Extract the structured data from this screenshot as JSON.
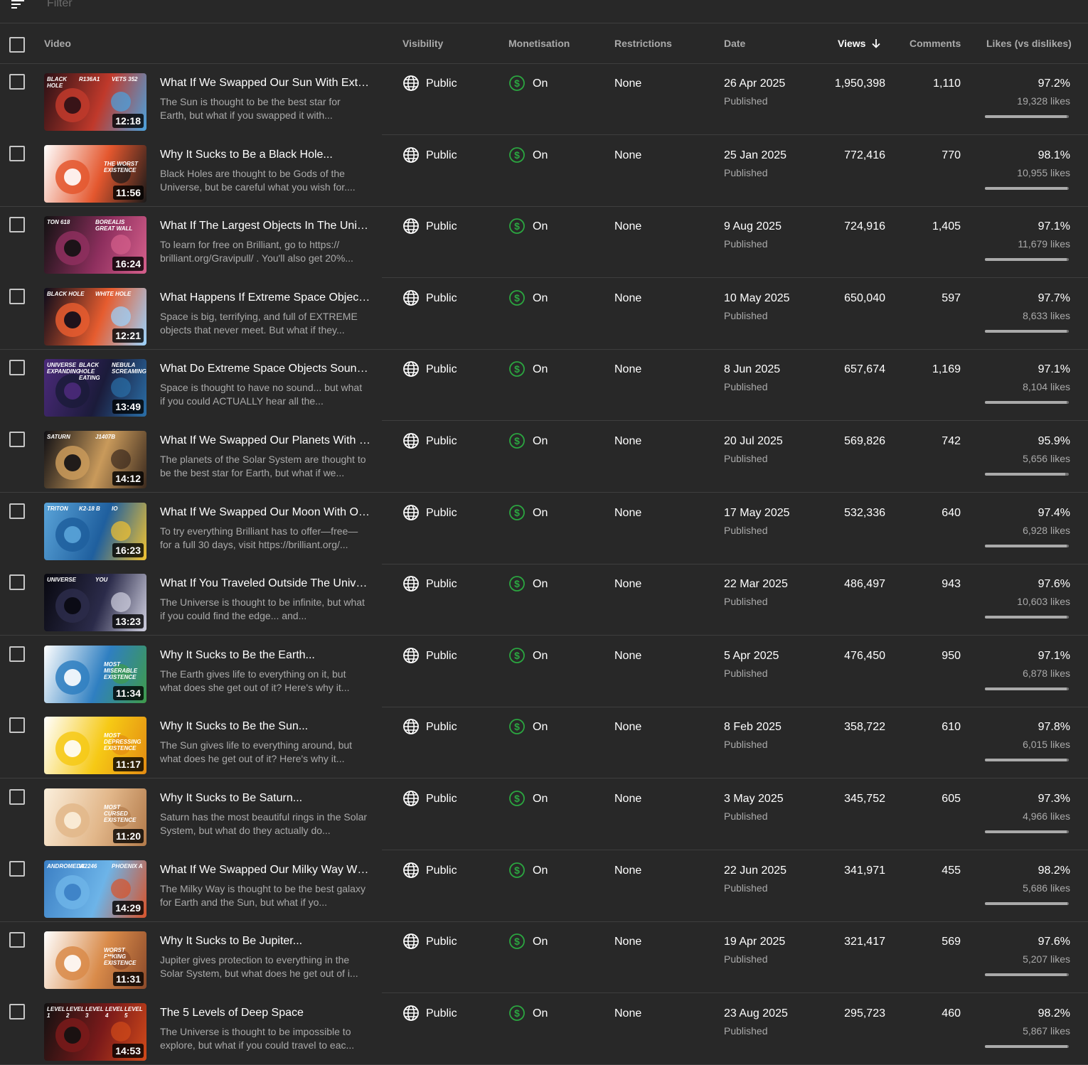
{
  "filter": {
    "placeholder": "Filter"
  },
  "columns": {
    "video": "Video",
    "visibility": "Visibility",
    "monetisation": "Monetisation",
    "restrictions": "Restrictions",
    "date": "Date",
    "views": "Views",
    "comments": "Comments",
    "likes": "Likes (vs dislikes)"
  },
  "colors": {
    "monetisation_green": "#2ba640",
    "divider": "#3e3e3e"
  },
  "rows": [
    {
      "title": "What If We Swapped Our Sun With Extre...",
      "desc": "The Sun is thought to be the best star for Earth, but what if you swapped it with...",
      "duration": "12:18",
      "thumb_captions": [
        "BLACK HOLE",
        "R136A1",
        "VETS 352"
      ],
      "thumb_colors": [
        "#2a1015",
        "#c0392b",
        "#4aa3df"
      ],
      "visibility": "Public",
      "monetisation": "On",
      "restrictions": "None",
      "date": "26 Apr 2025",
      "status": "Published",
      "views": "1,950,398",
      "comments": "1,110",
      "likes_pct": "97.2%",
      "likes": "19,328 likes",
      "ratio": 0.972
    },
    {
      "title": "Why It Sucks to Be a Black Hole...",
      "desc": "Black Holes are thought to be Gods of the Universe, but be careful what you wish for....",
      "duration": "11:56",
      "thumb_captions": [
        "THE WORST EXISTENCE"
      ],
      "thumb_colors": [
        "#ffffff",
        "#e4572e",
        "#1a1a1a"
      ],
      "visibility": "Public",
      "monetisation": "On",
      "restrictions": "None",
      "date": "25 Jan 2025",
      "status": "Published",
      "views": "772,416",
      "comments": "770",
      "likes_pct": "98.1%",
      "likes": "10,955 likes",
      "ratio": 0.981
    },
    {
      "title": "What If The Largest Objects In The Unive...",
      "desc": "To learn for free on Brilliant, go to https:// brilliant.org/Gravipull/ . You'll also get 20%...",
      "duration": "16:24",
      "thumb_captions": [
        "TON 618",
        "BOREALIS GREAT WALL"
      ],
      "thumb_colors": [
        "#111111",
        "#8e2f5e",
        "#d6608c"
      ],
      "visibility": "Public",
      "monetisation": "On",
      "restrictions": "None",
      "date": "9 Aug 2025",
      "status": "Published",
      "views": "724,916",
      "comments": "1,405",
      "likes_pct": "97.1%",
      "likes": "11,679 likes",
      "ratio": 0.971
    },
    {
      "title": "What Happens If Extreme Space Objects...",
      "desc": "Space is big, terrifying, and full of EXTREME objects that never meet. But what if they...",
      "duration": "12:21",
      "thumb_captions": [
        "BLACK HOLE",
        "WHITE HOLE"
      ],
      "thumb_colors": [
        "#0b0b1a",
        "#e65c2f",
        "#9ad4ff"
      ],
      "visibility": "Public",
      "monetisation": "On",
      "restrictions": "None",
      "date": "10 May 2025",
      "status": "Published",
      "views": "650,040",
      "comments": "597",
      "likes_pct": "97.7%",
      "likes": "8,633 likes",
      "ratio": 0.977
    },
    {
      "title": "What Do Extreme Space Objects Sound ...",
      "desc": "Space is thought to have no sound... but what if you could ACTUALLY hear all the...",
      "duration": "13:49",
      "thumb_captions": [
        "UNIVERSE EXPANDING",
        "BLACK HOLE EATING",
        "NEBULA SCREAMING"
      ],
      "thumb_colors": [
        "#4b2a7a",
        "#1b1b3a",
        "#2a6fa8"
      ],
      "visibility": "Public",
      "monetisation": "On",
      "restrictions": "None",
      "date": "8 Jun 2025",
      "status": "Published",
      "views": "657,674",
      "comments": "1,169",
      "likes_pct": "97.1%",
      "likes": "8,104 likes",
      "ratio": 0.971
    },
    {
      "title": "What If We Swapped Our Planets With E...",
      "desc": "The planets of the Solar System are thought to be the best star for Earth, but what if we...",
      "duration": "14:12",
      "thumb_captions": [
        "SATURN",
        "J1407B"
      ],
      "thumb_colors": [
        "#0f0f14",
        "#c99a5b",
        "#3b2a1e"
      ],
      "visibility": "Public",
      "monetisation": "On",
      "restrictions": "None",
      "date": "20 Jul 2025",
      "status": "Published",
      "views": "569,826",
      "comments": "742",
      "likes_pct": "95.9%",
      "likes": "5,656 likes",
      "ratio": 0.959
    },
    {
      "title": "What If We Swapped Our Moon With Oth...",
      "desc": "To try everything Brilliant has to offer—free—for a full 30 days, visit https://brilliant.org/...",
      "duration": "16:23",
      "thumb_captions": [
        "TRITON",
        "K2-18 B",
        "IO"
      ],
      "thumb_colors": [
        "#5aa4d9",
        "#1f5f9e",
        "#f2c230"
      ],
      "visibility": "Public",
      "monetisation": "On",
      "restrictions": "None",
      "date": "17 May 2025",
      "status": "Published",
      "views": "532,336",
      "comments": "640",
      "likes_pct": "97.4%",
      "likes": "6,928 likes",
      "ratio": 0.974
    },
    {
      "title": "What If You Traveled Outside The Univer...",
      "desc": "The Universe is thought to be infinite, but what if you could find the edge... and...",
      "duration": "13:23",
      "thumb_captions": [
        "UNIVERSE",
        "YOU"
      ],
      "thumb_colors": [
        "#08080f",
        "#2b2b4a",
        "#d0d0e0"
      ],
      "visibility": "Public",
      "monetisation": "On",
      "restrictions": "None",
      "date": "22 Mar 2025",
      "status": "Published",
      "views": "486,497",
      "comments": "943",
      "likes_pct": "97.6%",
      "likes": "10,603 likes",
      "ratio": 0.976
    },
    {
      "title": "Why It Sucks to Be the Earth...",
      "desc": "The Earth gives life to everything on it, but what does she get out of it? Here's why it...",
      "duration": "11:34",
      "thumb_captions": [
        "MOST MISERABLE EXISTENCE"
      ],
      "thumb_colors": [
        "#ffffff",
        "#2f7fc1",
        "#3f9b4a"
      ],
      "visibility": "Public",
      "monetisation": "On",
      "restrictions": "None",
      "date": "5 Apr 2025",
      "status": "Published",
      "views": "476,450",
      "comments": "950",
      "likes_pct": "97.1%",
      "likes": "6,878 likes",
      "ratio": 0.971
    },
    {
      "title": "Why It Sucks to Be the Sun...",
      "desc": "The Sun gives life to everything around, but what does he get out of it? Here's why it...",
      "duration": "11:17",
      "thumb_captions": [
        "MOST DEPRESSING EXISTENCE"
      ],
      "thumb_colors": [
        "#ffffff",
        "#f6c915",
        "#e38b12"
      ],
      "visibility": "Public",
      "monetisation": "On",
      "restrictions": "None",
      "date": "8 Feb 2025",
      "status": "Published",
      "views": "358,722",
      "comments": "610",
      "likes_pct": "97.8%",
      "likes": "6,015 likes",
      "ratio": 0.978
    },
    {
      "title": "Why It Sucks to Be Saturn...",
      "desc": "Saturn has the most beautiful rings in the Solar System, but what do they actually do...",
      "duration": "11:20",
      "thumb_captions": [
        "MOST CURSED EXISTENCE"
      ],
      "thumb_colors": [
        "#fbefdc",
        "#e2b78a",
        "#b27a4a"
      ],
      "visibility": "Public",
      "monetisation": "On",
      "restrictions": "None",
      "date": "3 May 2025",
      "status": "Published",
      "views": "345,752",
      "comments": "605",
      "likes_pct": "97.3%",
      "likes": "4,966 likes",
      "ratio": 0.973
    },
    {
      "title": "What If We Swapped Our Milky Way With...",
      "desc": "The Milky Way is thought to be the best galaxy for Earth and the Sun, but what if yo...",
      "duration": "14:29",
      "thumb_captions": [
        "ANDROMEDA",
        "W2246",
        "PHOENIX A"
      ],
      "thumb_colors": [
        "#3b7fc4",
        "#6db4e8",
        "#d9532a"
      ],
      "visibility": "Public",
      "monetisation": "On",
      "restrictions": "None",
      "date": "22 Jun 2025",
      "status": "Published",
      "views": "341,971",
      "comments": "455",
      "likes_pct": "98.2%",
      "likes": "5,686 likes",
      "ratio": 0.982
    },
    {
      "title": "Why It Sucks to Be Jupiter...",
      "desc": "Jupiter gives protection to everything in the Solar System, but what does he get out of i...",
      "duration": "11:31",
      "thumb_captions": [
        "WORST F**KING EXISTENCE"
      ],
      "thumb_colors": [
        "#ffffff",
        "#d98b4a",
        "#8c4a2a"
      ],
      "visibility": "Public",
      "monetisation": "On",
      "restrictions": "None",
      "date": "19 Apr 2025",
      "status": "Published",
      "views": "321,417",
      "comments": "569",
      "likes_pct": "97.6%",
      "likes": "5,207 likes",
      "ratio": 0.976
    },
    {
      "title": "The 5 Levels of Deep Space",
      "desc": "The Universe is thought to be impossible to explore, but what if you could travel to eac...",
      "duration": "14:53",
      "thumb_captions": [
        "LEVEL 1",
        "LEVEL 2",
        "LEVEL 3",
        "LEVEL 4",
        "LEVEL 5"
      ],
      "thumb_colors": [
        "#111111",
        "#7a1a1a",
        "#d24a1a"
      ],
      "visibility": "Public",
      "monetisation": "On",
      "restrictions": "None",
      "date": "23 Aug 2025",
      "status": "Published",
      "views": "295,723",
      "comments": "460",
      "likes_pct": "98.2%",
      "likes": "5,867 likes",
      "ratio": 0.982
    }
  ]
}
